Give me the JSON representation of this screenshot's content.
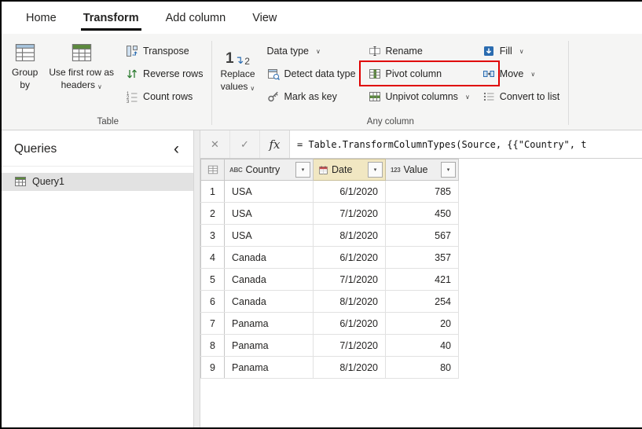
{
  "colors": {
    "highlight_red": "#e00000",
    "selected_column_header": "#f1e7c2",
    "active_tab_underline": "#000000",
    "ribbon_background": "#f5f5f4"
  },
  "icons": {
    "dropdown_caret": "∨",
    "filter_caret": "▾",
    "collapse_chevron": "‹"
  },
  "menubar": {
    "tabs": [
      {
        "label": "Home",
        "active": false
      },
      {
        "label": "Transform",
        "active": true
      },
      {
        "label": "Add column",
        "active": false
      },
      {
        "label": "View",
        "active": false
      }
    ]
  },
  "ribbon": {
    "groups": [
      {
        "label": "Table",
        "buttons": {
          "group_by": {
            "line1": "Group",
            "line2": "by"
          },
          "use_first_row": {
            "line1": "Use first row as",
            "line2": "headers",
            "has_dropdown": true
          },
          "transpose": {
            "label": "Transpose"
          },
          "reverse_rows": {
            "label": "Reverse rows"
          },
          "count_rows": {
            "label": "Count rows"
          }
        }
      },
      {
        "label": "Any column",
        "buttons": {
          "replace_values": {
            "line1": "Replace",
            "line2": "values",
            "has_dropdown": true
          },
          "data_type": {
            "label": "Data type",
            "has_dropdown": true
          },
          "detect_data_type": {
            "label": "Detect data type"
          },
          "mark_as_key": {
            "label": "Mark as key"
          },
          "rename": {
            "label": "Rename"
          },
          "pivot_column": {
            "label": "Pivot column",
            "highlighted": true
          },
          "unpivot_columns": {
            "label": "Unpivot columns",
            "has_dropdown": true
          },
          "fill": {
            "label": "Fill",
            "has_dropdown": true
          },
          "move": {
            "label": "Move",
            "has_dropdown": true
          },
          "convert_to_list": {
            "label": "Convert to list"
          }
        }
      }
    ]
  },
  "sidebar": {
    "title": "Queries",
    "items": [
      {
        "label": "Query1",
        "selected": true
      }
    ]
  },
  "formula_bar": {
    "cancel_icon": "✕",
    "check_icon": "✓",
    "fx_label": "fx",
    "formula": "= Table.TransformColumnTypes(Source, {{\"Country\", t"
  },
  "table": {
    "columns": [
      {
        "name": "Country",
        "type": "text",
        "type_glyph": "ABC",
        "selected": false
      },
      {
        "name": "Date",
        "type": "date",
        "selected": true
      },
      {
        "name": "Value",
        "type": "number",
        "type_glyph": "123",
        "selected": false
      }
    ],
    "rows": [
      {
        "num": "1",
        "country": "USA",
        "date": "6/1/2020",
        "value": "785"
      },
      {
        "num": "2",
        "country": "USA",
        "date": "7/1/2020",
        "value": "450"
      },
      {
        "num": "3",
        "country": "USA",
        "date": "8/1/2020",
        "value": "567"
      },
      {
        "num": "4",
        "country": "Canada",
        "date": "6/1/2020",
        "value": "357"
      },
      {
        "num": "5",
        "country": "Canada",
        "date": "7/1/2020",
        "value": "421"
      },
      {
        "num": "6",
        "country": "Canada",
        "date": "8/1/2020",
        "value": "254"
      },
      {
        "num": "7",
        "country": "Panama",
        "date": "6/1/2020",
        "value": "20"
      },
      {
        "num": "8",
        "country": "Panama",
        "date": "7/1/2020",
        "value": "40"
      },
      {
        "num": "9",
        "country": "Panama",
        "date": "8/1/2020",
        "value": "80"
      }
    ]
  }
}
